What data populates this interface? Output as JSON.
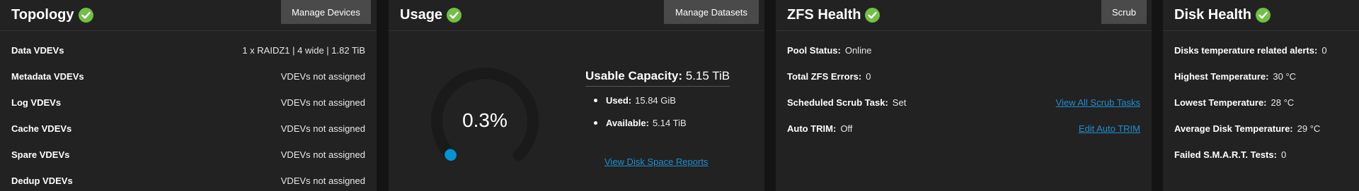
{
  "colors": {
    "card_bg": "#222222",
    "page_bg": "#141414",
    "success_green": "#71bf44",
    "link_blue": "#1f8fd1",
    "gauge_track": "#1a1a1a",
    "gauge_fill": "#0095d5",
    "button_bg": "#4a4a4a"
  },
  "topology": {
    "title": "Topology",
    "status_icon": "check-circle-icon",
    "button": "Manage Devices",
    "rows": [
      {
        "label": "Data VDEVs",
        "value": "1 x RAIDZ1 | 4 wide | 1.82 TiB"
      },
      {
        "label": "Metadata VDEVs",
        "value": "VDEVs not assigned"
      },
      {
        "label": "Log VDEVs",
        "value": "VDEVs not assigned"
      },
      {
        "label": "Cache VDEVs",
        "value": "VDEVs not assigned"
      },
      {
        "label": "Spare VDEVs",
        "value": "VDEVs not assigned"
      },
      {
        "label": "Dedup VDEVs",
        "value": "VDEVs not assigned"
      }
    ]
  },
  "usage": {
    "title": "Usage",
    "status_icon": "check-circle-icon",
    "button": "Manage Datasets",
    "gauge_percent_text": "0.3%",
    "gauge_fraction": 0.003,
    "capacity_label": "Usable Capacity:",
    "capacity_value": "5.15 TiB",
    "used_label": "Used:",
    "used_value": "15.84 GiB",
    "available_label": "Available:",
    "available_value": "5.14 TiB",
    "reports_link": "View Disk Space Reports"
  },
  "zfs_health": {
    "title": "ZFS Health",
    "status_icon": "check-circle-icon",
    "button": "Scrub",
    "rows": [
      {
        "label": "Pool Status:",
        "value": "Online",
        "link": ""
      },
      {
        "label": "Total ZFS Errors:",
        "value": "0",
        "link": ""
      },
      {
        "label": "Scheduled Scrub Task:",
        "value": "Set",
        "link": "View All Scrub Tasks"
      },
      {
        "label": "Auto TRIM:",
        "value": "Off",
        "link": "Edit Auto TRIM"
      }
    ]
  },
  "disk_health": {
    "title": "Disk Health",
    "status_icon": "check-circle-icon",
    "rows": [
      {
        "label": "Disks temperature related alerts:",
        "value": "0"
      },
      {
        "label": "Highest Temperature:",
        "value": "30 °C"
      },
      {
        "label": "Lowest Temperature:",
        "value": "28 °C"
      },
      {
        "label": "Average Disk Temperature:",
        "value": "29 °C"
      },
      {
        "label": "Failed S.M.A.R.T. Tests:",
        "value": "0"
      }
    ]
  }
}
